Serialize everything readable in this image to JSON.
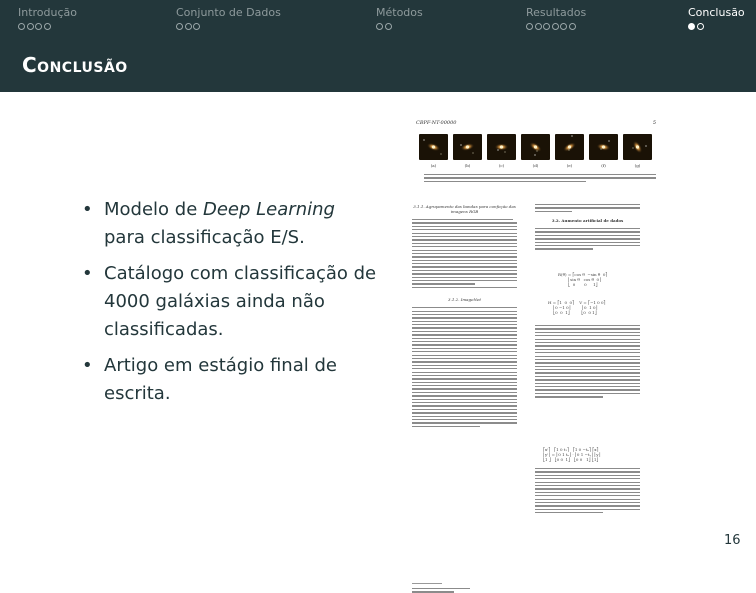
{
  "nav": {
    "sections": [
      {
        "label": "Introdução",
        "dots": 4,
        "filled": 0,
        "active": false
      },
      {
        "label": "Conjunto de Dados",
        "dots": 3,
        "filled": 0,
        "active": false
      },
      {
        "label": "Métodos",
        "dots": 2,
        "filled": 0,
        "active": false
      },
      {
        "label": "Resultados",
        "dots": 6,
        "filled": 0,
        "active": false
      },
      {
        "label": "Conclusão",
        "dots": 2,
        "filled": 1,
        "active": true
      }
    ]
  },
  "slide": {
    "title": "Conclusão",
    "bullets": [
      {
        "pre": "Modelo de ",
        "em": "Deep Learning",
        "post": " para classificação E/S."
      },
      {
        "pre": "Catálogo com classificação de 4000 galáxias ainda não classificadas.",
        "em": "",
        "post": ""
      },
      {
        "pre": "Artigo em estágio final de escrita.",
        "em": "",
        "post": ""
      }
    ],
    "page_number": "16"
  },
  "paper": {
    "header_left": "CBPF-NT-00000",
    "header_right": "5",
    "thumb_labels": [
      "(a)",
      "(b)",
      "(c)",
      "(d)",
      "(e)",
      "(f)",
      "(g)"
    ],
    "section_left_1": "3.1.1. Agrupamento das bandas para confeção das imagens RGB",
    "section_left_2": "3.1.2. ImageNet",
    "section_right": "3.2. Aumento artificial de dados",
    "colors": {
      "sky": "#1a1206",
      "galaxy_core": "#fff2c8",
      "galaxy_halo": "#c98a3a"
    }
  }
}
